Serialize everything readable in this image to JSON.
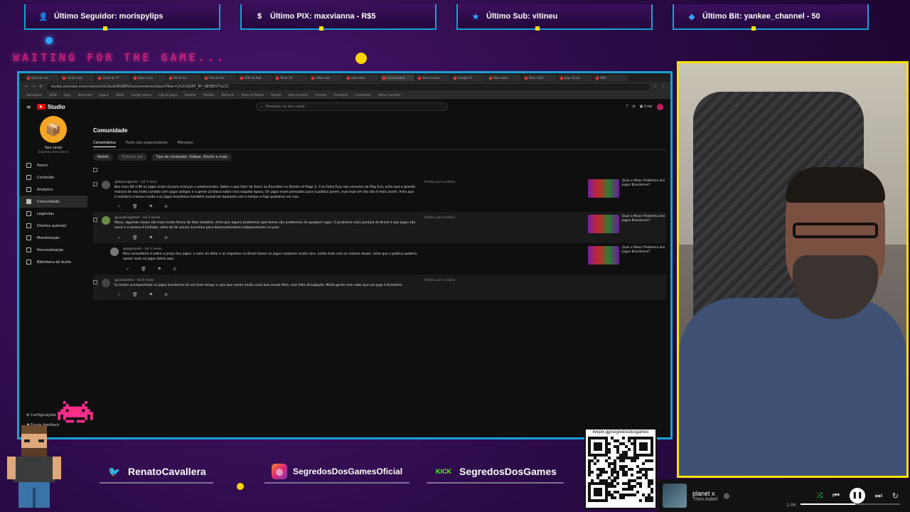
{
  "alerts": [
    {
      "icon": "user-icon",
      "label": "Último Seguidor: morispylips"
    },
    {
      "icon": "dollar-icon",
      "label": "Último PIX: maxvianna - R$5"
    },
    {
      "icon": "star-icon",
      "label": "Último Sub: vitineu"
    },
    {
      "icon": "diamond-icon",
      "label": "Último Bit: yankee_channel - 50"
    }
  ],
  "overlay": {
    "waiting_text": "WAITING FOR THE GAME..."
  },
  "browser": {
    "tabs": [
      "Odio de nos",
      "Como criar",
      "Canal do YT",
      "Boas e pla",
      "Dé de Co",
      "Procure De",
      "ZOE do Rob",
      "Tetris 10",
      "Vídeo sob",
      "ada todos",
      "Comunidade",
      "Dres sonaro",
      "Google Dr",
      "Ebo moisé",
      "Marc 2022",
      "Jogo 10 pa",
      "OMC"
    ],
    "active_tab": 10,
    "url": "studio.youtube.com/channel/UCAuzD8GBE6Sn/comments/inbox?filter=[%22SORT_BY_NEWEST%22]",
    "bookmarks": [
      "Aplicativos",
      "SGSB",
      "Apps",
      "Infracrash",
      "Jogos2",
      "Storik",
      "Google tokens",
      "Liga do Jogos",
      "Refrator",
      "FatSlots",
      "Desserts",
      "Todos no Roblox",
      "Rumbo",
      "Ade cocinaria",
      "Corredor",
      "Fundação",
      "Livestream",
      "Outros favoritos"
    ]
  },
  "studio": {
    "logo": "Studio",
    "search_placeholder": "Pesquise no seu canal",
    "create_label": "Criar",
    "channel_name": "Seu canal",
    "channel_sub": "Segredos dos Games",
    "nav": [
      "Painel",
      "Conteúdo",
      "Analytics",
      "Comunidade",
      "Legendas",
      "Direitos autorais",
      "Monetização",
      "Personalização",
      "Biblioteca de áudio"
    ],
    "active_nav": 3,
    "settings_label": "Configurações",
    "feedback_label": "Enviar feedback",
    "page_title": "Comunidade",
    "tabs": [
      "Comentários",
      "Posts dos espectadores",
      "Menções"
    ],
    "active_tab": 0,
    "filters": [
      "Retido",
      "Ordenar por",
      "Tipo de conteúdo: Vídeos, Shorts e mais"
    ],
    "comments": [
      {
        "author": "@algumgamer - há 1 hora",
        "text": "Nos anos 80 e 90 os jogos eram só para crianças e adolescentes. Sobre o que falar de Sonic ou Knuckles no Streets of Rage 2, 3 ou Fatal Fury nas consoles da Play Eco, acho que a grande maioria de nós tinha contato com jogos antigos e a gente já falava sobre isso naquela época. Os jogos eram pensados para o público jovem, mas hoje em dia não é mais assim. Acho que a indústria cresceu muito e os jogos brasileiros também evoluíram bastante com o tempo e hoje podemos ver isso.",
        "status": "Retido para análise",
        "video": "Qual o Maior Problema dos Jogos Brasileiros?"
      },
      {
        "author": "@usuariogamer - há 2 horas",
        "text": "Mano, algumas coisas são mais muito fáceis de falar também. Acho que alguns problemas que temos são problemas de qualquer lugar. O problema mais pontual do Brasil é que jogos são caros e o acesso é limitado, além de ter pouco incentivo para desenvolvedores independentes no país.",
        "status": "Retido para análise",
        "video": "Qual o Maior Problema dos Jogos Brasileiros?"
      },
      {
        "author": "@jogadorbr - há 3 horas",
        "text": "Meu comentário é sobre o preço dos jogos: o valor do dólar e os impostos no Brasil fazem os jogos custarem muito caro, ainda mais com os valores atuais. Acho que o público poderia apoiar mais os jogos feitos aqui.",
        "status": "",
        "video": "Qual o Maior Problema dos Jogos Brasileiros?"
      },
      {
        "author": "@canalretro - há 4 horas",
        "text": "Eu tenho acompanhado os jogos brasileiros há um bom tempo e vejo que existe muita coisa boa sendo feita, mas falta divulgação. Muita gente nem sabe que um jogo é brasileiro.",
        "status": "Retido para análise",
        "video": ""
      }
    ]
  },
  "social": [
    {
      "icon": "twitter-icon",
      "label": "RenatoCavallera"
    },
    {
      "icon": "instagram-icon",
      "label": "SegredosDosGamesOficial"
    },
    {
      "icon": "kick-icon",
      "icon_text": "KICK",
      "label": "SegredosDosGames"
    }
  ],
  "qr": {
    "label": "livepix.gg/segredosdosgames"
  },
  "player": {
    "title": "planet x",
    "artist": "Theo Aabel",
    "time": "1:06",
    "progress": 0.55
  },
  "colors": {
    "accent": "#1c9fd6",
    "webcam_border": "#ffe100",
    "magenta": "#ff2d8c"
  }
}
